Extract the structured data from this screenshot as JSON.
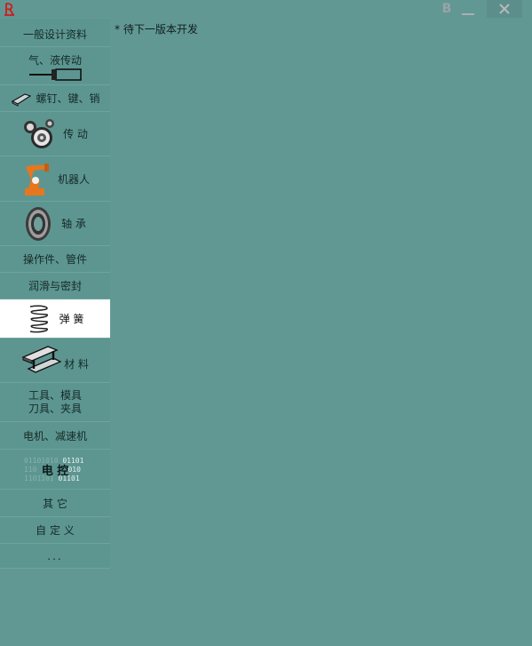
{
  "title_bar": {
    "b_label": "B",
    "minimize_label": "_",
    "close_label": "×"
  },
  "sidebar": {
    "items": [
      {
        "label": "一般设计资料"
      },
      {
        "label": "气、液传动"
      },
      {
        "label": "螺钉、键、销"
      },
      {
        "label": "传 动"
      },
      {
        "label": "机器人"
      },
      {
        "label": "轴 承"
      },
      {
        "label": "操作件、管件"
      },
      {
        "label": "润滑与密封"
      },
      {
        "label": "弹 簧"
      },
      {
        "label": "材 料"
      },
      {
        "line1": "工具、模具",
        "line2": "刀具、夹具"
      },
      {
        "label": "电机、减速机"
      },
      {
        "label": "电 控",
        "binary1": "01101010",
        "binary1b": "01101",
        "binary2": "110",
        "binary2b": "010",
        "binary3": "1101101",
        "binary3b": "01101"
      },
      {
        "label": "其 它"
      },
      {
        "label": "自 定 义"
      },
      {
        "label": "..."
      }
    ],
    "selected_index": 8
  },
  "content": {
    "status_text": "* 待下一版本开发"
  },
  "colors": {
    "background": "#619894",
    "sidebar_item": "#5d9691",
    "selected_item": "#ffffff",
    "robot_orange": "#e8761c",
    "logo_red": "#d11a1a"
  }
}
